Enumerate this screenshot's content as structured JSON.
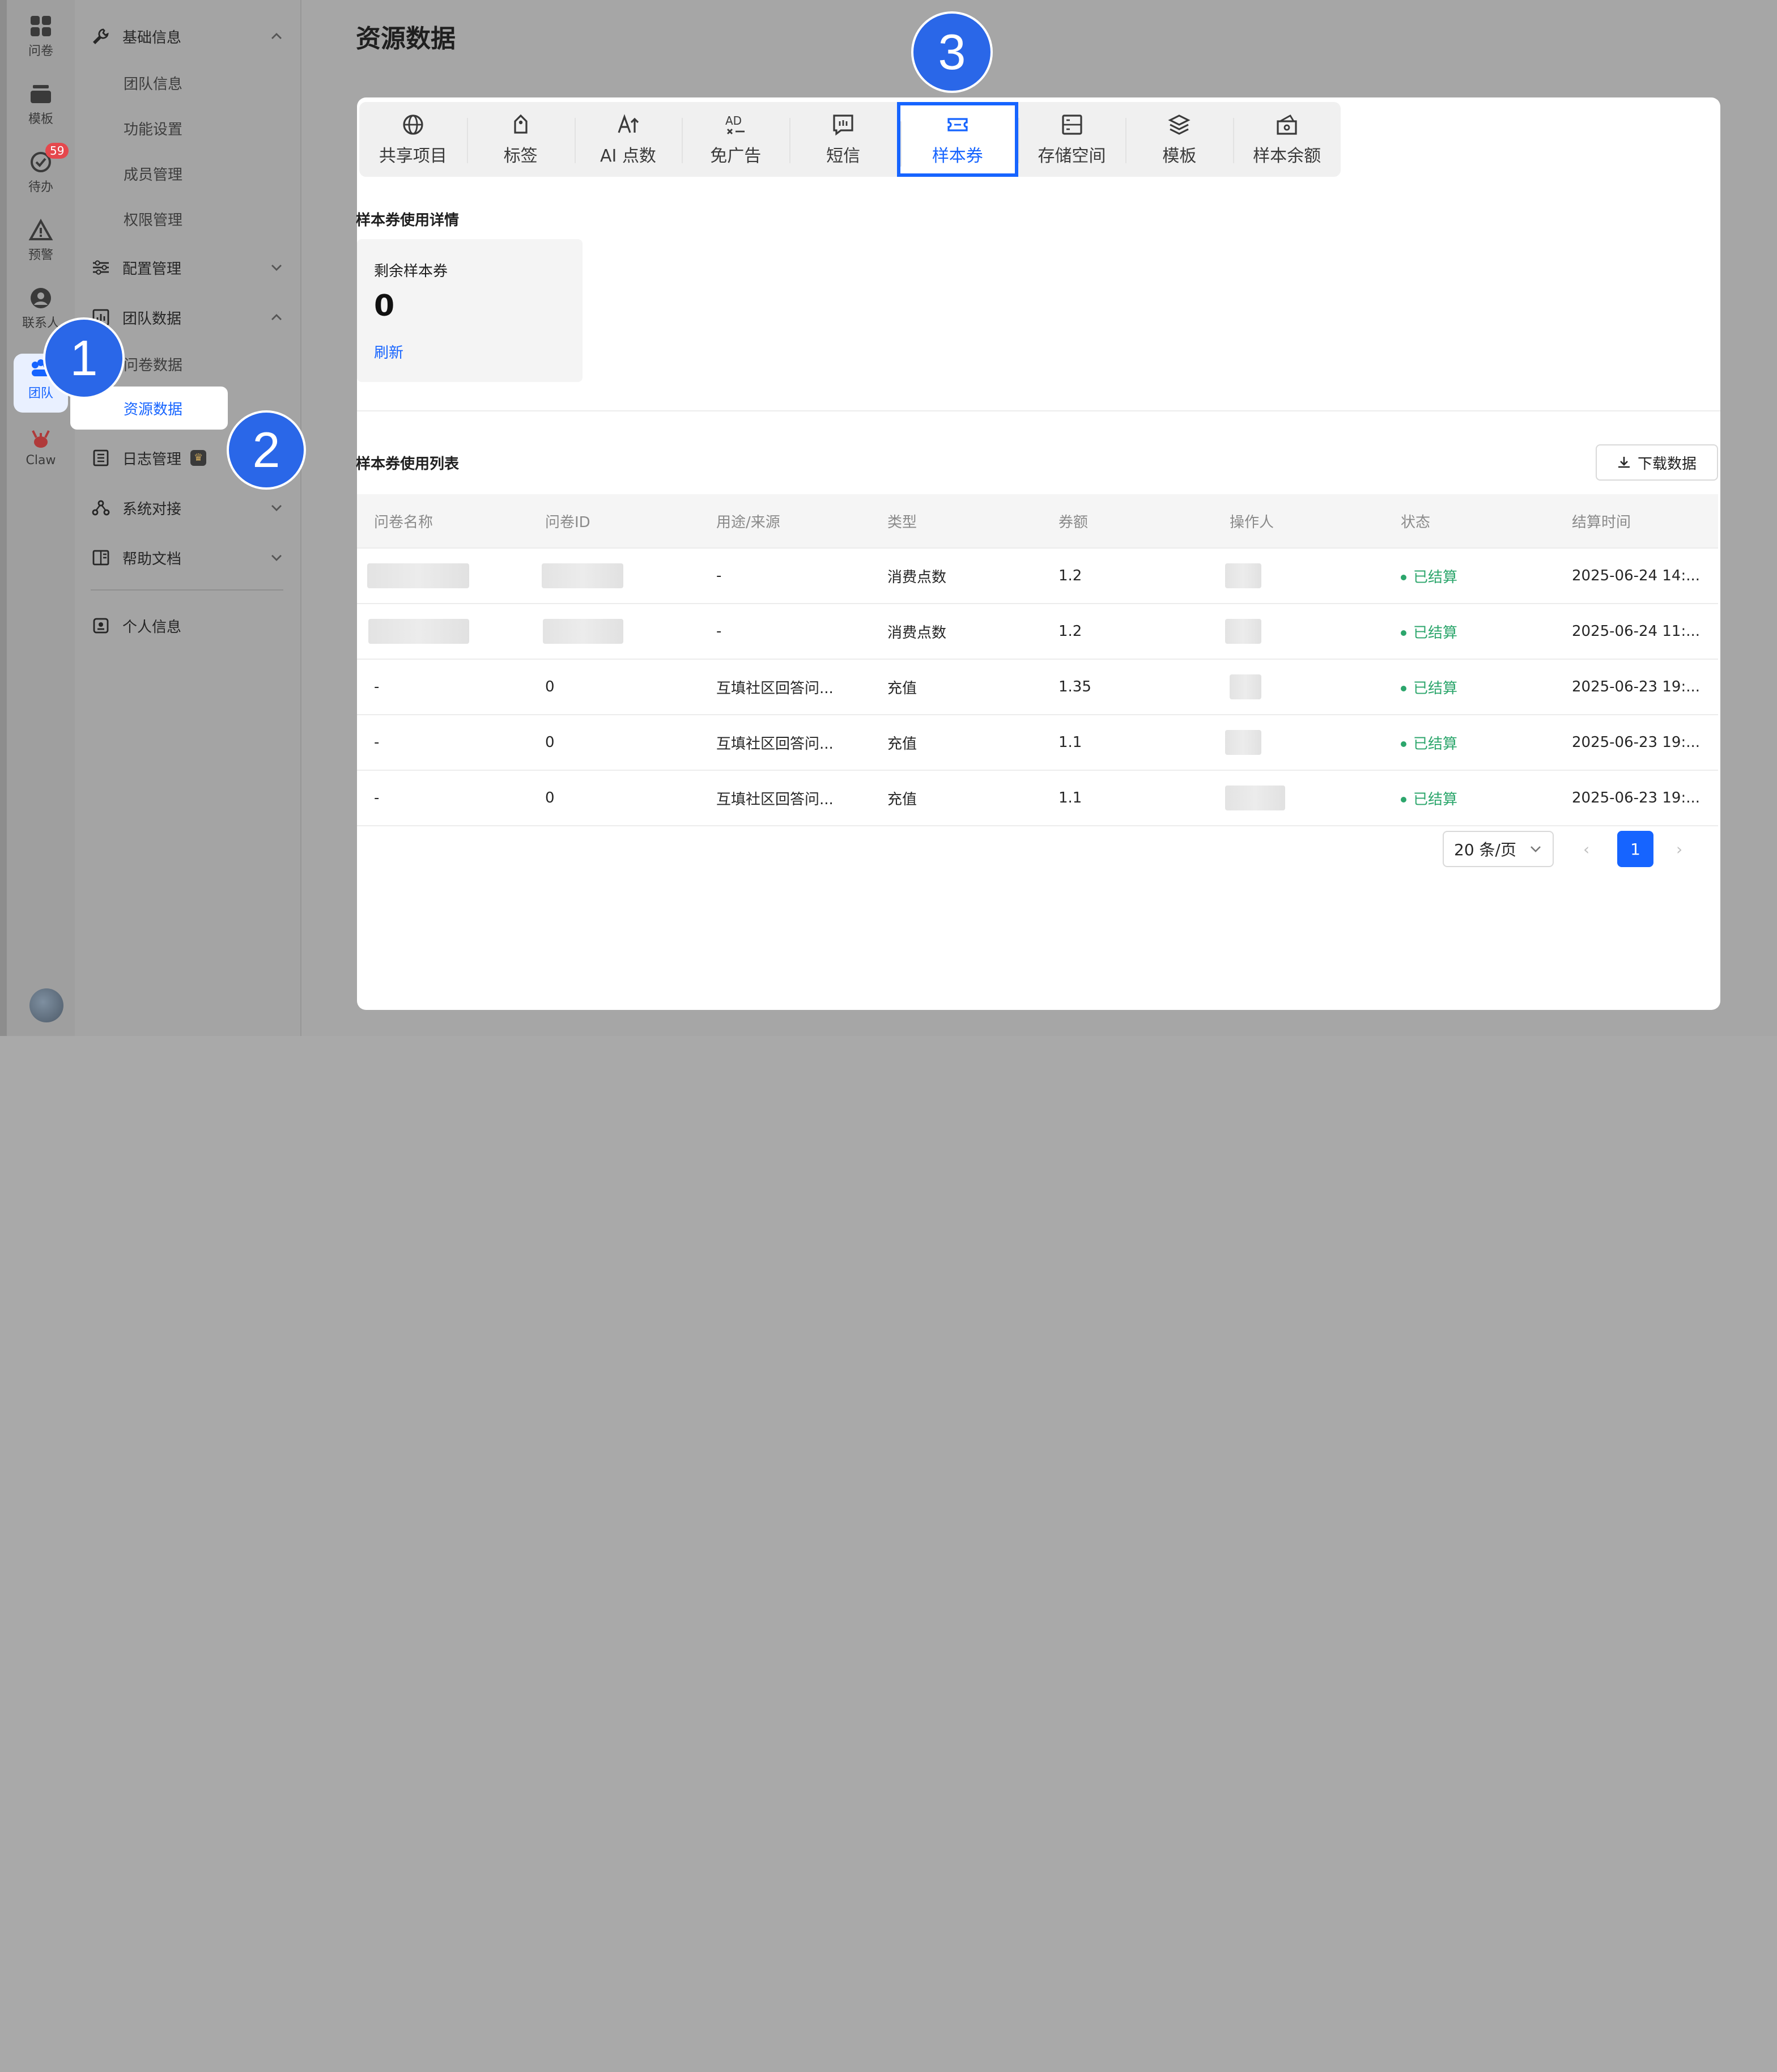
{
  "rail": {
    "items": [
      {
        "label": "问卷",
        "icon": "grid-icon"
      },
      {
        "label": "模板",
        "icon": "stack-icon"
      },
      {
        "label": "待办",
        "icon": "check-circle-icon",
        "badge": "59"
      },
      {
        "label": "预警",
        "icon": "warning-icon"
      },
      {
        "label": "联系人",
        "icon": "contact-icon"
      },
      {
        "label": "团队",
        "icon": "team-icon"
      },
      {
        "label": "Claw",
        "icon": "claw-icon"
      }
    ]
  },
  "sidebar": {
    "groups": {
      "basic": {
        "label": "基础信息",
        "items": [
          "团队信息",
          "功能设置",
          "成员管理",
          "权限管理"
        ]
      },
      "config": {
        "label": "配置管理"
      },
      "team_data": {
        "label": "团队数据",
        "items": [
          "问卷数据",
          "资源数据"
        ]
      },
      "log": {
        "label": "日志管理"
      },
      "integration": {
        "label": "系统对接"
      },
      "help": {
        "label": "帮助文档"
      },
      "profile": {
        "label": "个人信息"
      }
    }
  },
  "main": {
    "title": "资源数据",
    "tabs": [
      "共享项目",
      "标签",
      "AI 点数",
      "免广告",
      "短信",
      "样本券",
      "存储空间",
      "模板",
      "样本余额"
    ],
    "active_tab": "样本券",
    "usage_title": "样本券使用详情",
    "card": {
      "label": "剩余样本券",
      "value": "0",
      "refresh": "刷新"
    },
    "list_title": "样本券使用列表",
    "download_label": "下载数据",
    "table": {
      "headers": [
        "问卷名称",
        "问卷ID",
        "用途/来源",
        "类型",
        "券额",
        "操作人",
        "状态",
        "结算时间"
      ],
      "rows": [
        {
          "purpose": "-",
          "type": "消费点数",
          "amount": "1.2",
          "status": "已结算",
          "time": "2025-06-24 14:..."
        },
        {
          "purpose": "-",
          "type": "消费点数",
          "amount": "1.2",
          "status": "已结算",
          "time": "2025-06-24 11:..."
        },
        {
          "name": "-",
          "id": "0",
          "purpose": "互填社区回答问...",
          "type": "充值",
          "amount": "1.35",
          "status": "已结算",
          "time": "2025-06-23 19:..."
        },
        {
          "name": "-",
          "id": "0",
          "purpose": "互填社区回答问...",
          "type": "充值",
          "amount": "1.1",
          "status": "已结算",
          "time": "2025-06-23 19:..."
        },
        {
          "name": "-",
          "id": "0",
          "purpose": "互填社区回答问...",
          "type": "充值",
          "amount": "1.1",
          "status": "已结算",
          "time": "2025-06-23 19:..."
        }
      ]
    },
    "pagination": {
      "page_size": "20 条/页",
      "current": "1"
    }
  },
  "callouts": [
    "1",
    "2",
    "3"
  ],
  "colors": {
    "accent": "#1664ff",
    "success": "#2ca66c",
    "callout": "#2a67e8",
    "badge": "#e5484d"
  }
}
